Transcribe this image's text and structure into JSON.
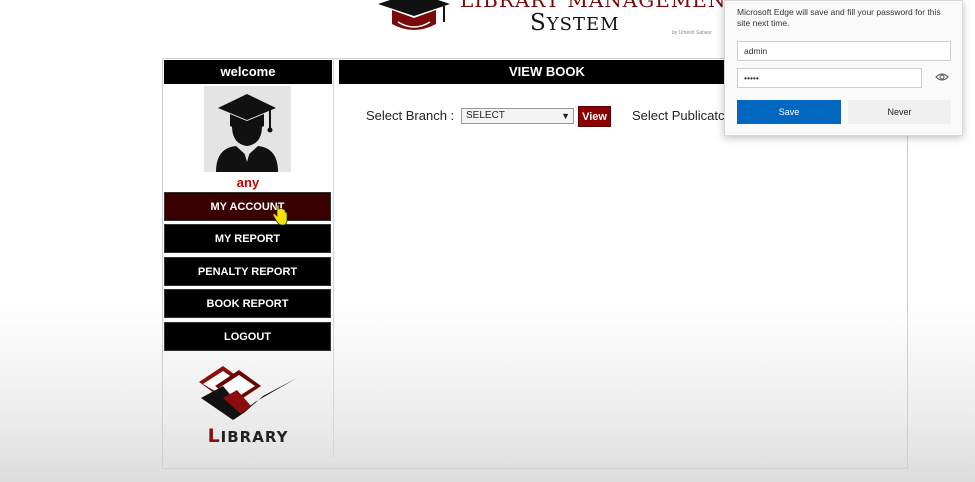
{
  "header": {
    "title_line1": "LIBRARY MANAGEMENT",
    "title_line2_first": "S",
    "title_line2_rest": "YSTEM",
    "credit": "by Umesh Sahani"
  },
  "sidebar": {
    "welcome": "welcome",
    "username": "any",
    "menu": [
      {
        "label": "MY ACCOUNT"
      },
      {
        "label": "MY REPORT"
      },
      {
        "label": "PENALTY REPORT"
      },
      {
        "label": "BOOK REPORT"
      },
      {
        "label": "LOGOUT"
      }
    ],
    "logo_first": "L",
    "logo_rest": "IBRARY"
  },
  "main": {
    "section_title": "VIEW BOOK",
    "branch_label": "Select Branch :",
    "branch_value": "SELECT",
    "view_button": "View",
    "publication_label": "Select Publicatc"
  },
  "password_prompt": {
    "message": "Microsoft Edge will save and fill your password for this site next time.",
    "username_value": "admin",
    "password_value": "•••••",
    "save_label": "Save",
    "never_label": "Never"
  },
  "colors": {
    "brand_dark_red": "#8b0000",
    "edge_blue": "#0067c0",
    "username_red": "#c00000"
  }
}
